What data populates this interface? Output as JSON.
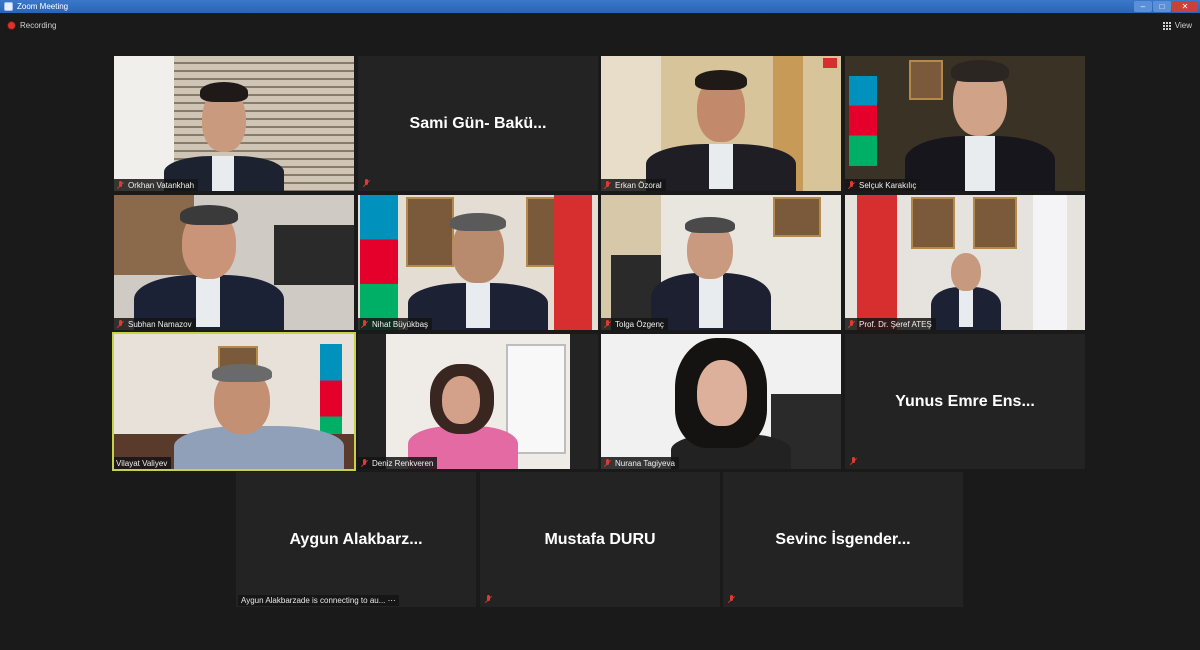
{
  "window": {
    "title": "Zoom Meeting"
  },
  "toolbar": {
    "recording_label": "Recording",
    "view_label": "View"
  },
  "tiles": [
    {
      "name": "Orkhan Vatankhah",
      "type": "video"
    },
    {
      "name": "Sami Gün- Bakü...",
      "type": "name"
    },
    {
      "name": "Erkan Özoral",
      "type": "video"
    },
    {
      "name": "Selçuk Karakılıç",
      "type": "video"
    },
    {
      "name": "Subhan Namazov",
      "type": "video"
    },
    {
      "name": "Nihat Büyükbaş",
      "type": "video"
    },
    {
      "name": "Tolga  Özgenç",
      "type": "video"
    },
    {
      "name": "Prof. Dr. Şeref ATEŞ",
      "type": "video"
    },
    {
      "name": "Vilayat Valiyev",
      "type": "video",
      "active": true
    },
    {
      "name": "Deniz Renkveren",
      "type": "video"
    },
    {
      "name": "Nurana Tagiyeva",
      "type": "video"
    },
    {
      "name": "Yunus Emre Ens...",
      "type": "name"
    },
    {
      "name": "Aygun  Alakbarz...",
      "type": "name",
      "status": "Aygun Alakbarzade is connecting to au..."
    },
    {
      "name": "Mustafa DURU",
      "type": "name"
    },
    {
      "name": "Sevinc  İsgender...",
      "type": "name"
    }
  ],
  "colors": {
    "active_border": "#c7d24a",
    "muted": "#e03a33",
    "recording": "#e0312b"
  }
}
